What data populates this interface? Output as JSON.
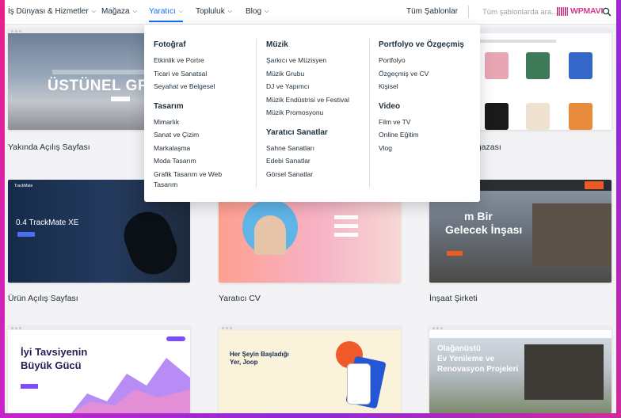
{
  "nav": {
    "items": [
      {
        "label": "İş Dünyası & Hizmetler"
      },
      {
        "label": "Mağaza"
      },
      {
        "label": "Yaratıcı"
      },
      {
        "label": "Topluluk"
      },
      {
        "label": "Blog"
      }
    ],
    "all_templates": "Tüm Şablonlar",
    "search_placeholder": "Tüm şablonlarda ara...",
    "watermark": "WPMAVI",
    "accent": "#116dff"
  },
  "dropdown": {
    "col1": {
      "g1": {
        "title": "Fotoğraf",
        "links": [
          "Etkinlik ve Portre",
          "Ticari ve Sanatsal",
          "Seyahat ve Belgesel"
        ]
      },
      "g2": {
        "title": "Tasarım",
        "links": [
          "Mimarlık",
          "Sanat ve Çizim",
          "Markalaşma",
          "Moda Tasarım",
          "Grafik Tasarım ve Web",
          "Tasarım"
        ]
      }
    },
    "col2": {
      "g1": {
        "title": "Müzik",
        "links": [
          "Şarkıcı ve Müzisyen",
          "Müzik Grubu",
          "DJ ve Yapımcı",
          "Müzik Endüstrisi ve Festival",
          "Müzik Promosyonu"
        ]
      },
      "g2": {
        "title": "Yaratıcı Sanatlar",
        "links": [
          "Sahne Sanatları",
          "Edebi Sanatlar",
          "Görsel Sanatlar"
        ]
      }
    },
    "col3": {
      "g1": {
        "title": "Portfolyo ve Özgeçmiş",
        "links": [
          "Portfolyo",
          "Özgeçmiş ve CV",
          "Kişisel"
        ]
      },
      "g2": {
        "title": "Video",
        "links": [
          "Film ve TV",
          "Online Eğitim",
          "Vlog"
        ]
      }
    }
  },
  "cards": {
    "c1": {
      "caption": "Yakında Açılış Sayfası",
      "hero": "ÜSTÜNEL GRUP"
    },
    "c2": {
      "caption": "ağazası"
    },
    "c3": {
      "caption": "Ürün Açılış Sayfası",
      "brand": "TrackMate",
      "hero": "0.4 TrackMate XE"
    },
    "c4": {
      "caption": "Yaratıcı CV"
    },
    "c5": {
      "caption": "İnşaat Şirketi",
      "hero1": "m Bir",
      "hero2": "Gelecek İnşası"
    },
    "c6": {
      "caption": "",
      "hero1": "İyi Tavsiyenin",
      "hero2": "Büyük Gücü"
    },
    "c7": {
      "caption": "",
      "hero1": "Her Şeyin Başladığı",
      "hero2": "Yer, Joop"
    },
    "c8": {
      "caption": "",
      "hero1": "Olağanüstü",
      "hero2": "Ev Yenileme ve",
      "hero3": "Renovasyon Projeleri"
    }
  }
}
